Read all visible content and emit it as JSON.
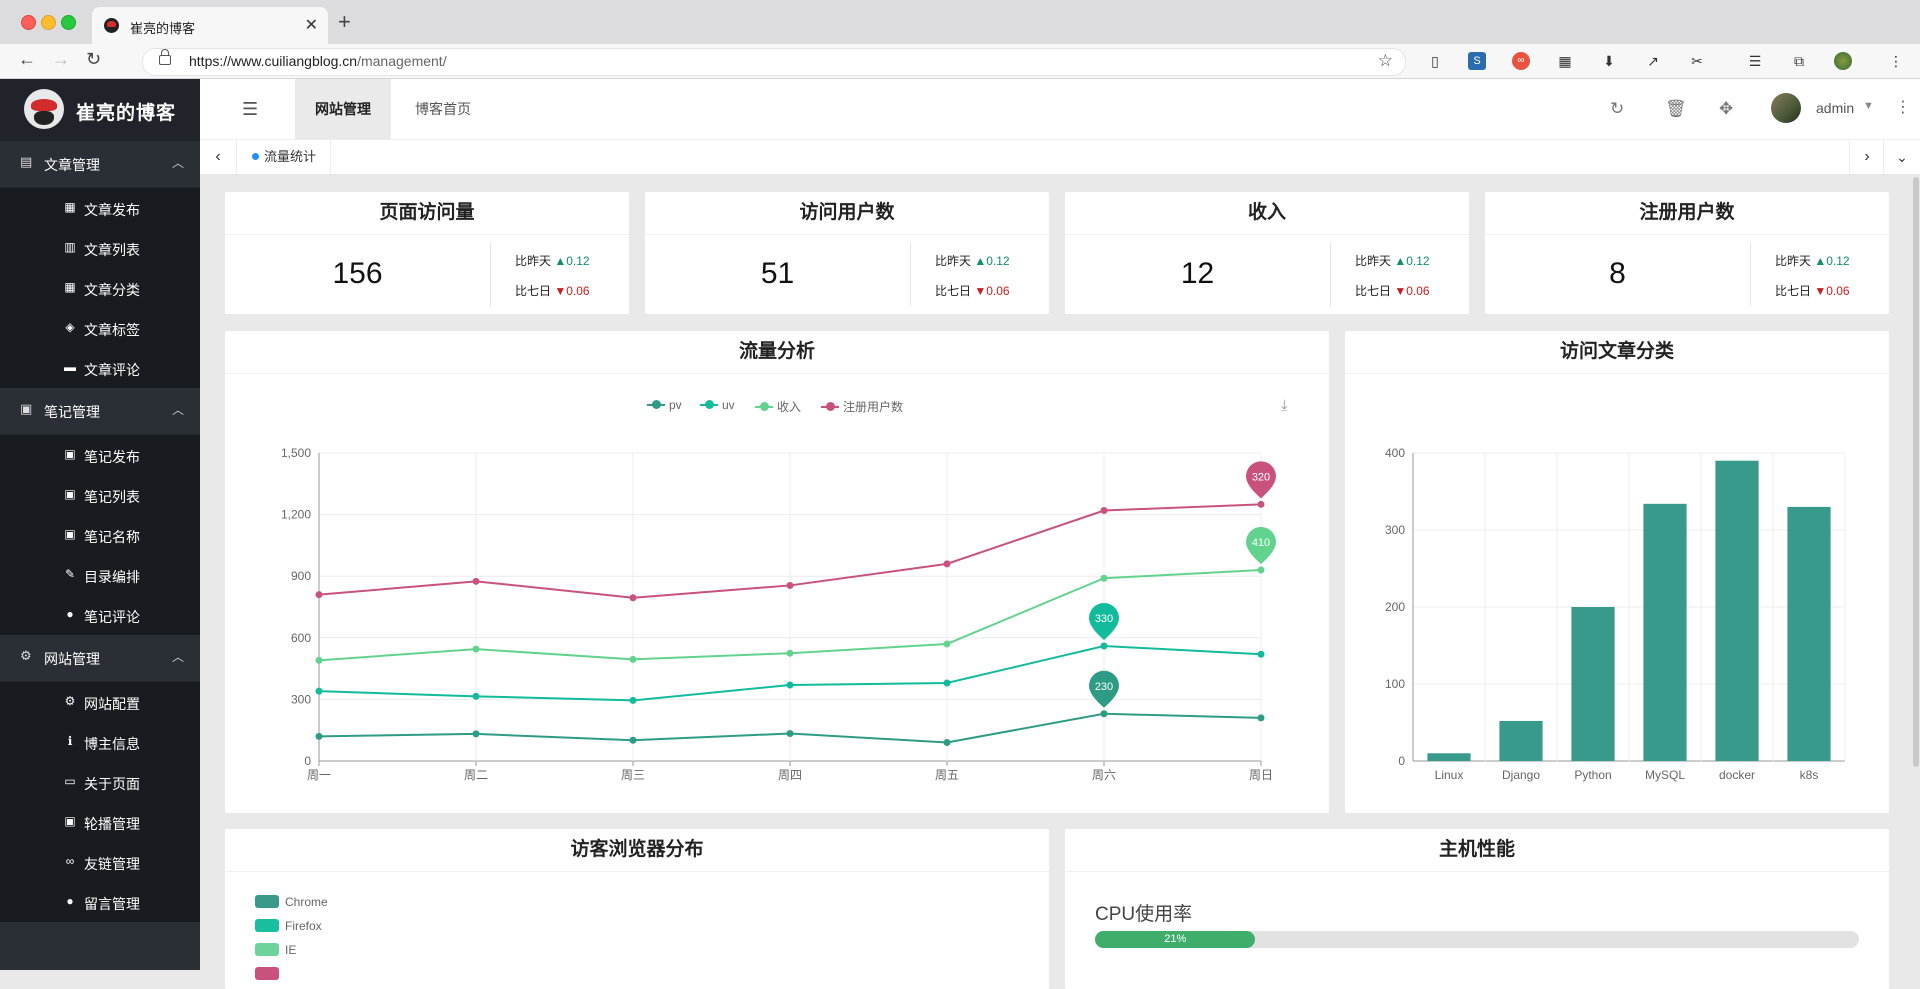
{
  "browser": {
    "tab_title": "崔亮的博客",
    "new_tab": "+",
    "url_host": "https://www.cuiliangblog.cn",
    "url_path": "/management/"
  },
  "sidebar": {
    "logo_text": "崔亮的博客",
    "groups": [
      {
        "label": "文章管理",
        "icon": "calendar-icon",
        "items": [
          {
            "label": "文章发布",
            "icon": "calendar-icon"
          },
          {
            "label": "文章列表",
            "icon": "clipboard-icon"
          },
          {
            "label": "文章分类",
            "icon": "calendar-grid-icon"
          },
          {
            "label": "文章标签",
            "icon": "tags-icon"
          },
          {
            "label": "文章评论",
            "icon": "comment-icon"
          }
        ]
      },
      {
        "label": "笔记管理",
        "icon": "book-icon",
        "items": [
          {
            "label": "笔记发布",
            "icon": "book-icon"
          },
          {
            "label": "笔记列表",
            "icon": "book-icon"
          },
          {
            "label": "笔记名称",
            "icon": "book-icon"
          },
          {
            "label": "目录编排",
            "icon": "pen-icon"
          },
          {
            "label": "笔记评论",
            "icon": "comment-icon"
          }
        ]
      },
      {
        "label": "网站管理",
        "icon": "gears-icon",
        "items": [
          {
            "label": "网站配置",
            "icon": "gear-icon"
          },
          {
            "label": "博主信息",
            "icon": "info-icon"
          },
          {
            "label": "关于页面",
            "icon": "hdd-icon"
          },
          {
            "label": "轮播管理",
            "icon": "slideshow-icon"
          },
          {
            "label": "友链管理",
            "icon": "link-icon"
          },
          {
            "label": "留言管理",
            "icon": "comments-icon"
          }
        ]
      }
    ]
  },
  "header": {
    "tabs": [
      "网站管理",
      "博客首页"
    ],
    "user": "admin"
  },
  "tabbar": {
    "active_tab": "流量统计"
  },
  "stats": [
    {
      "title": "页面访问量",
      "value": "156",
      "day_label": "比昨天",
      "day_delta": "0.12",
      "week_label": "比七日",
      "week_delta": "0.06"
    },
    {
      "title": "访问用户数",
      "value": "51",
      "day_label": "比昨天",
      "day_delta": "0.12",
      "week_label": "比七日",
      "week_delta": "0.06"
    },
    {
      "title": "收入",
      "value": "12",
      "day_label": "比昨天",
      "day_delta": "0.12",
      "week_label": "比七日",
      "week_delta": "0.06"
    },
    {
      "title": "注册用户数",
      "value": "8",
      "day_label": "比昨天",
      "day_delta": "0.12",
      "week_label": "比七日",
      "week_delta": "0.06"
    }
  ],
  "traffic_title": "流量分析",
  "category_title": "访问文章分类",
  "browser_title": "访客浏览器分布",
  "host_title": "主机性能",
  "cpu_label": "CPU使用率",
  "cpu_percent": 21,
  "cpu_text": "21%",
  "browser_legend": [
    {
      "name": "Chrome",
      "color": "#3a9a8a"
    },
    {
      "name": "Firefox",
      "color": "#17bfa0"
    },
    {
      "name": "IE",
      "color": "#6cd49a"
    }
  ],
  "colors": {
    "pv": "#2e9c84",
    "uv": "#12bb9c",
    "income": "#62d38e",
    "register": "#c9517e",
    "bar": "#389a8a"
  },
  "chart_data": [
    {
      "type": "line",
      "title": "流量分析",
      "categories": [
        "周一",
        "周二",
        "周三",
        "周四",
        "周五",
        "周六",
        "周日"
      ],
      "ylim": [
        0,
        1500
      ],
      "yticks": [
        "0",
        "300",
        "600",
        "900",
        "1,200",
        "1,500"
      ],
      "legend_position": "top-center",
      "series": [
        {
          "name": "pv",
          "values": [
            120,
            132,
            101,
            134,
            90,
            230,
            210
          ],
          "max_label": "230"
        },
        {
          "name": "uv",
          "values": [
            340,
            315,
            295,
            370,
            380,
            560,
            520
          ],
          "max_label": "330"
        },
        {
          "name": "收入",
          "values": [
            490,
            545,
            495,
            525,
            570,
            890,
            930
          ],
          "max_label": "410"
        },
        {
          "name": "注册用户数",
          "values": [
            810,
            875,
            795,
            855,
            960,
            1220,
            1250
          ],
          "max_label": "320"
        }
      ]
    },
    {
      "type": "bar",
      "title": "访问文章分类",
      "categories": [
        "Linux",
        "Django",
        "Python",
        "MySQL",
        "docker",
        "k8s"
      ],
      "values": [
        10,
        52,
        200,
        334,
        390,
        330
      ],
      "ylim": [
        0,
        400
      ],
      "yticks": [
        "0",
        "100",
        "200",
        "300",
        "400"
      ]
    }
  ]
}
